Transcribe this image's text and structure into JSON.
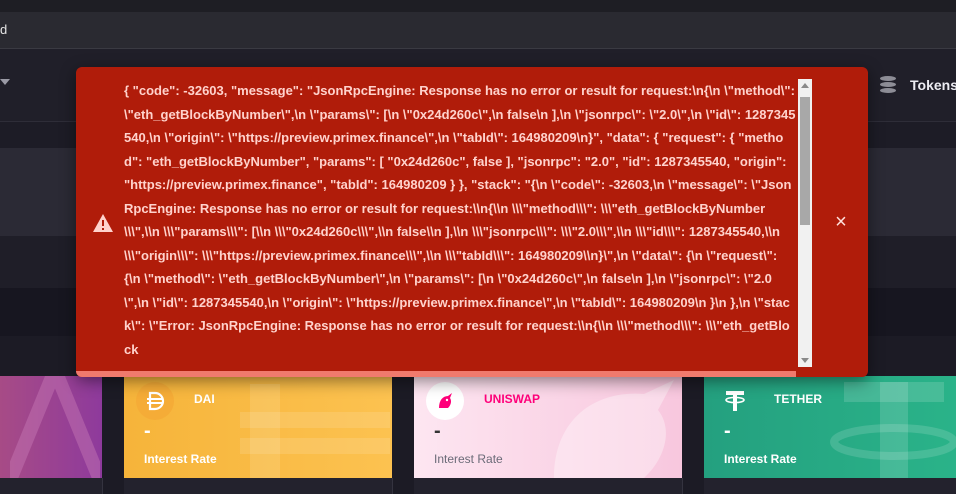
{
  "browser": {
    "url_fragment": "d"
  },
  "navbar": {
    "tokens_label": "Tokens",
    "tokens_icon": "coins-stack-icon"
  },
  "alert": {
    "message": "{ \"code\": -32603, \"message\": \"JsonRpcEngine: Response has no error or result for request:\\n{\\n \\\"method\\\": \\\"eth_getBlockByNumber\\\",\\n \\\"params\\\": [\\n \\\"0x24d260c\\\",\\n false\\n ],\\n \\\"jsonrpc\\\": \\\"2.0\\\",\\n \\\"id\\\": 1287345540,\\n \\\"origin\\\": \\\"https://preview.primex.finance\\\",\\n \\\"tabId\\\": 164980209\\n}\", \"data\": { \"request\": { \"method\": \"eth_getBlockByNumber\", \"params\": [ \"0x24d260c\", false ], \"jsonrpc\": \"2.0\", \"id\": 1287345540, \"origin\": \"https://preview.primex.finance\", \"tabId\": 164980209 } }, \"stack\": \"{\\n \\\"code\\\": -32603,\\n \\\"message\\\": \\\"JsonRpcEngine: Response has no error or result for request:\\\\n{\\\\n \\\\\\\"method\\\\\\\": \\\\\\\"eth_getBlockByNumber\\\\\\\",\\\\n \\\\\\\"params\\\\\\\": [\\\\n \\\\\\\"0x24d260c\\\\\\\",\\\\n false\\\\n ],\\\\n \\\\\\\"jsonrpc\\\\\\\": \\\\\\\"2.0\\\\\\\",\\\\n \\\\\\\"id\\\\\\\": 1287345540,\\\\n \\\\\\\"origin\\\\\\\": \\\\\\\"https://preview.primex.finance\\\\\\\",\\\\n \\\\\\\"tabId\\\\\\\": 164980209\\\\n}\\\",\\n \\\"data\\\": {\\n \\\"request\\\": {\\n \\\"method\\\": \\\"eth_getBlockByNumber\\\",\\n \\\"params\\\": [\\n \\\"0x24d260c\\\",\\n false\\n ],\\n \\\"jsonrpc\\\": \\\"2.0\\\",\\n \\\"id\\\": 1287345540,\\n \\\"origin\\\": \\\"https://preview.primex.finance\\\",\\n \\\"tabId\\\": 164980209\\n }\\n },\\n \\\"stack\\\": \\\"Error: JsonRpcEngine: Response has no error or result for request:\\\\n{\\\\n \\\\\\\"method\\\\\\\": \\\\\\\"eth_getBlock",
    "icon": "warning-triangle-icon",
    "close_icon": "close-icon",
    "colors": {
      "background": "#b01c0a",
      "text": "#ffd2cc",
      "progress": "#f07a6d"
    }
  },
  "cards": [
    {
      "name": "DAI",
      "value": "-",
      "rate_label": "Interest Rate",
      "icon": "dai-icon",
      "color": "#fcc250"
    },
    {
      "name": "UNISWAP",
      "value": "-",
      "rate_label": "Interest Rate",
      "icon": "uniswap-unicorn-icon",
      "color": "#f8c7de"
    },
    {
      "name": "TETHER",
      "value": "-",
      "rate_label": "Interest Rate",
      "icon": "tether-icon",
      "color": "#2ab389"
    }
  ]
}
